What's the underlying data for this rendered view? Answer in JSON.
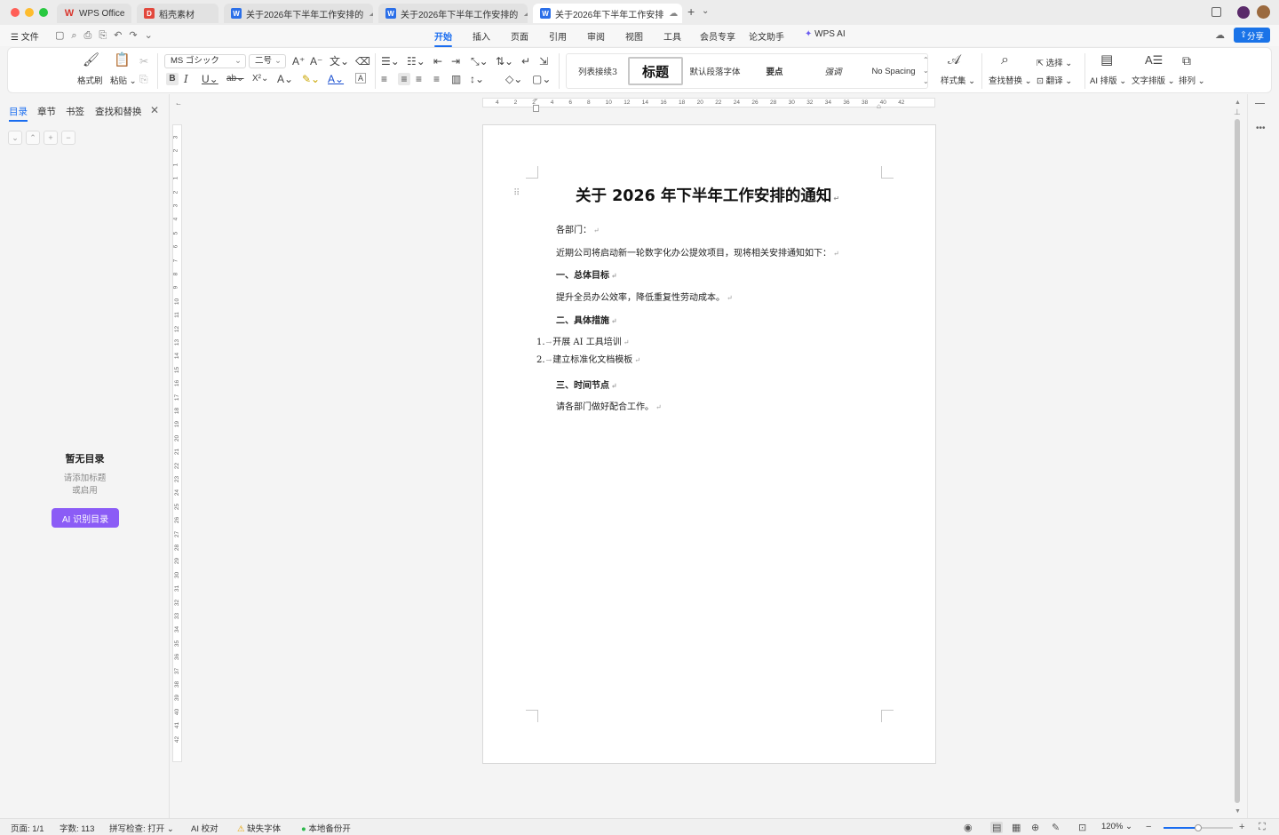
{
  "titlebar": {
    "tabs": [
      {
        "label": "WPS Office",
        "icon": "wps-logo"
      },
      {
        "label": "稻壳素材",
        "icon": "docer-logo"
      },
      {
        "label": "关于2026年下半年工作安排的",
        "icon": "word-doc"
      },
      {
        "label": "关于2026年下半年工作安排的",
        "icon": "word-doc"
      },
      {
        "label": "关于2026年下半年工作安排",
        "icon": "word-doc"
      }
    ],
    "new_tab": "+",
    "tab_menu": "⌄"
  },
  "menubar": {
    "file": "文件",
    "tabs": [
      "开始",
      "插入",
      "页面",
      "引用",
      "审阅",
      "视图",
      "工具",
      "会员专享",
      "论文助手",
      "WPS AI"
    ],
    "active_tab": "开始",
    "share": "分享"
  },
  "ribbon": {
    "format_painter": "格式刷",
    "paste": "粘贴",
    "font_name": "MS ゴシック",
    "font_size": "二号",
    "styles": [
      "列表接续3",
      "标题",
      "默认段落字体",
      "要点",
      "强调",
      "No Spacing"
    ],
    "style_set": "样式集",
    "find_replace": "查找替换",
    "select": "选择",
    "translate": "翻译",
    "ai_layout": "AI 排版",
    "text_layout": "文字排版",
    "arrange": "排列"
  },
  "leftpane": {
    "tabs": [
      "目录",
      "章节",
      "书签",
      "查找和替换"
    ],
    "active_tab": "目录",
    "empty_title": "暂无目录",
    "empty_hint_1": "请添加标题",
    "empty_hint_2": "或启用",
    "ai_button": "AI 识别目录"
  },
  "ruler": {
    "h_ticks": [
      "4",
      "2",
      "2",
      "4",
      "6",
      "8",
      "10",
      "12",
      "14",
      "16",
      "18",
      "20",
      "22",
      "24",
      "26",
      "28",
      "30",
      "32",
      "34",
      "36",
      "38",
      "40",
      "42"
    ],
    "v_ticks": [
      "3",
      "2",
      "1",
      "1",
      "2",
      "3",
      "4",
      "5",
      "6",
      "7",
      "8",
      "9",
      "10",
      "11",
      "12",
      "13",
      "14",
      "15",
      "16",
      "17",
      "18",
      "19",
      "20",
      "21",
      "22",
      "23",
      "24",
      "25",
      "26",
      "27",
      "28",
      "29",
      "30",
      "31",
      "32",
      "33",
      "34",
      "35",
      "36",
      "37",
      "38",
      "39",
      "40",
      "41",
      "42"
    ]
  },
  "document": {
    "title": "关于 2026 年下半年工作安排的通知",
    "salutation": "各部门：",
    "intro": "近期公司将启动新一轮数字化办公提效项目，现将相关安排通知如下：",
    "h1": "一、总体目标",
    "p1": "提升全员办公效率，降低重复性劳动成本。",
    "h2": "二、具体措施",
    "list": [
      {
        "num": "1.",
        "text": "开展  AI 工具培训"
      },
      {
        "num": "2.",
        "text": "建立标准化文档模板"
      }
    ],
    "h3": "三、时间节点",
    "p3": "请各部门做好配合工作。",
    "para_mark": "↵"
  },
  "statusbar": {
    "page": "页面: 1/1",
    "words": "字数: 113",
    "spell": "拼写检查: 打开",
    "ai_proof": "AI 校对",
    "missing_font": "缺失字体",
    "backup": "本地备份开",
    "zoom": "120%"
  },
  "colors": {
    "accent": "#1a6df0",
    "ai_button": "#8b5cf6",
    "share_button": "#1a73e8"
  }
}
